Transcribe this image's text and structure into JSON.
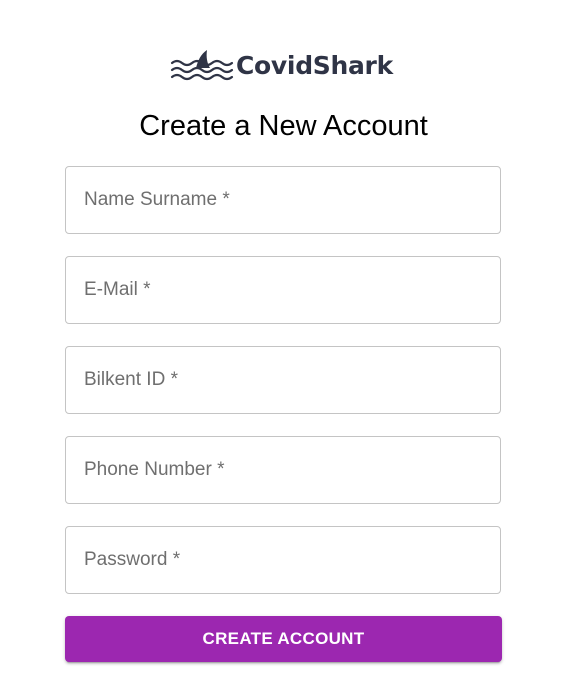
{
  "logo": {
    "text": "CovidShark",
    "icon": "shark-fin-waves-icon",
    "text_color": "#2f3446"
  },
  "page": {
    "title": "Create a New Account"
  },
  "form": {
    "fields": [
      {
        "placeholder": "Name Surname *",
        "value": ""
      },
      {
        "placeholder": "E-Mail *",
        "value": ""
      },
      {
        "placeholder": "Bilkent ID *",
        "value": ""
      },
      {
        "placeholder": "Phone Number *",
        "value": ""
      },
      {
        "placeholder": "Password *",
        "value": ""
      }
    ],
    "submit_label": "CREATE ACCOUNT"
  },
  "colors": {
    "accent": "#9c27b0",
    "border": "#c4c4c4",
    "placeholder": "#6f6f6f"
  }
}
